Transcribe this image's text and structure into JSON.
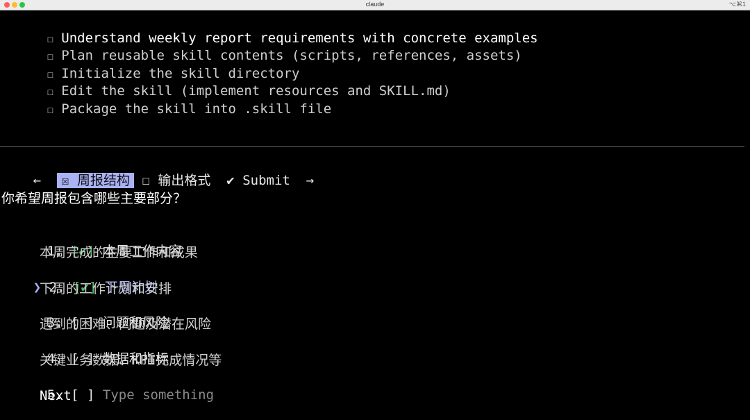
{
  "window": {
    "title": "claude",
    "shortcut": "⌥⌘1"
  },
  "tasks": [
    {
      "box": "☐",
      "label": "Understand weekly report requirements with concrete examples"
    },
    {
      "box": "☐",
      "label": "Plan reusable skill contents (scripts, references, assets)"
    },
    {
      "box": "☐",
      "label": "Initialize the skill directory"
    },
    {
      "box": "☐",
      "label": "Edit the skill (implement resources and SKILL.md)"
    },
    {
      "box": "☐",
      "label": "Package the skill into .skill file"
    }
  ],
  "tabs": {
    "left_arrow": "←",
    "right_arrow": "→",
    "items": [
      {
        "box": "☒",
        "label": "周报结构",
        "active": true
      },
      {
        "box": "☐",
        "label": "输出格式",
        "active": false
      },
      {
        "box": "✔",
        "label": "Submit",
        "active": false
      }
    ]
  },
  "question": "你希望周报包含哪些主要部分？",
  "options": [
    {
      "num": "1.",
      "mark": "[✔]",
      "label": "本周工作内容",
      "desc": "本周完成的主要工作和成果",
      "checked": true,
      "selected": false
    },
    {
      "num": "2.",
      "mark": "[✔]",
      "label": "下周计划",
      "desc": "下周的工作计划和安排",
      "checked": true,
      "selected": true
    },
    {
      "num": "3.",
      "mark": "[ ]",
      "label": "问题和风险",
      "desc": "遇到的困难、问题及潜在风险",
      "checked": false,
      "selected": false
    },
    {
      "num": "4.",
      "mark": "[ ]",
      "label": "数据和指标",
      "desc": "关键业务数据、KPI完成情况等",
      "checked": false,
      "selected": false
    },
    {
      "num": "5.",
      "mark": "[ ]",
      "label": "Type something",
      "checked": false,
      "selected": false
    }
  ],
  "pointer": "❯",
  "next_label": "Next",
  "colors": {
    "accent": "#a9b2f5",
    "check": "#4fbf67",
    "background": "#000000"
  }
}
